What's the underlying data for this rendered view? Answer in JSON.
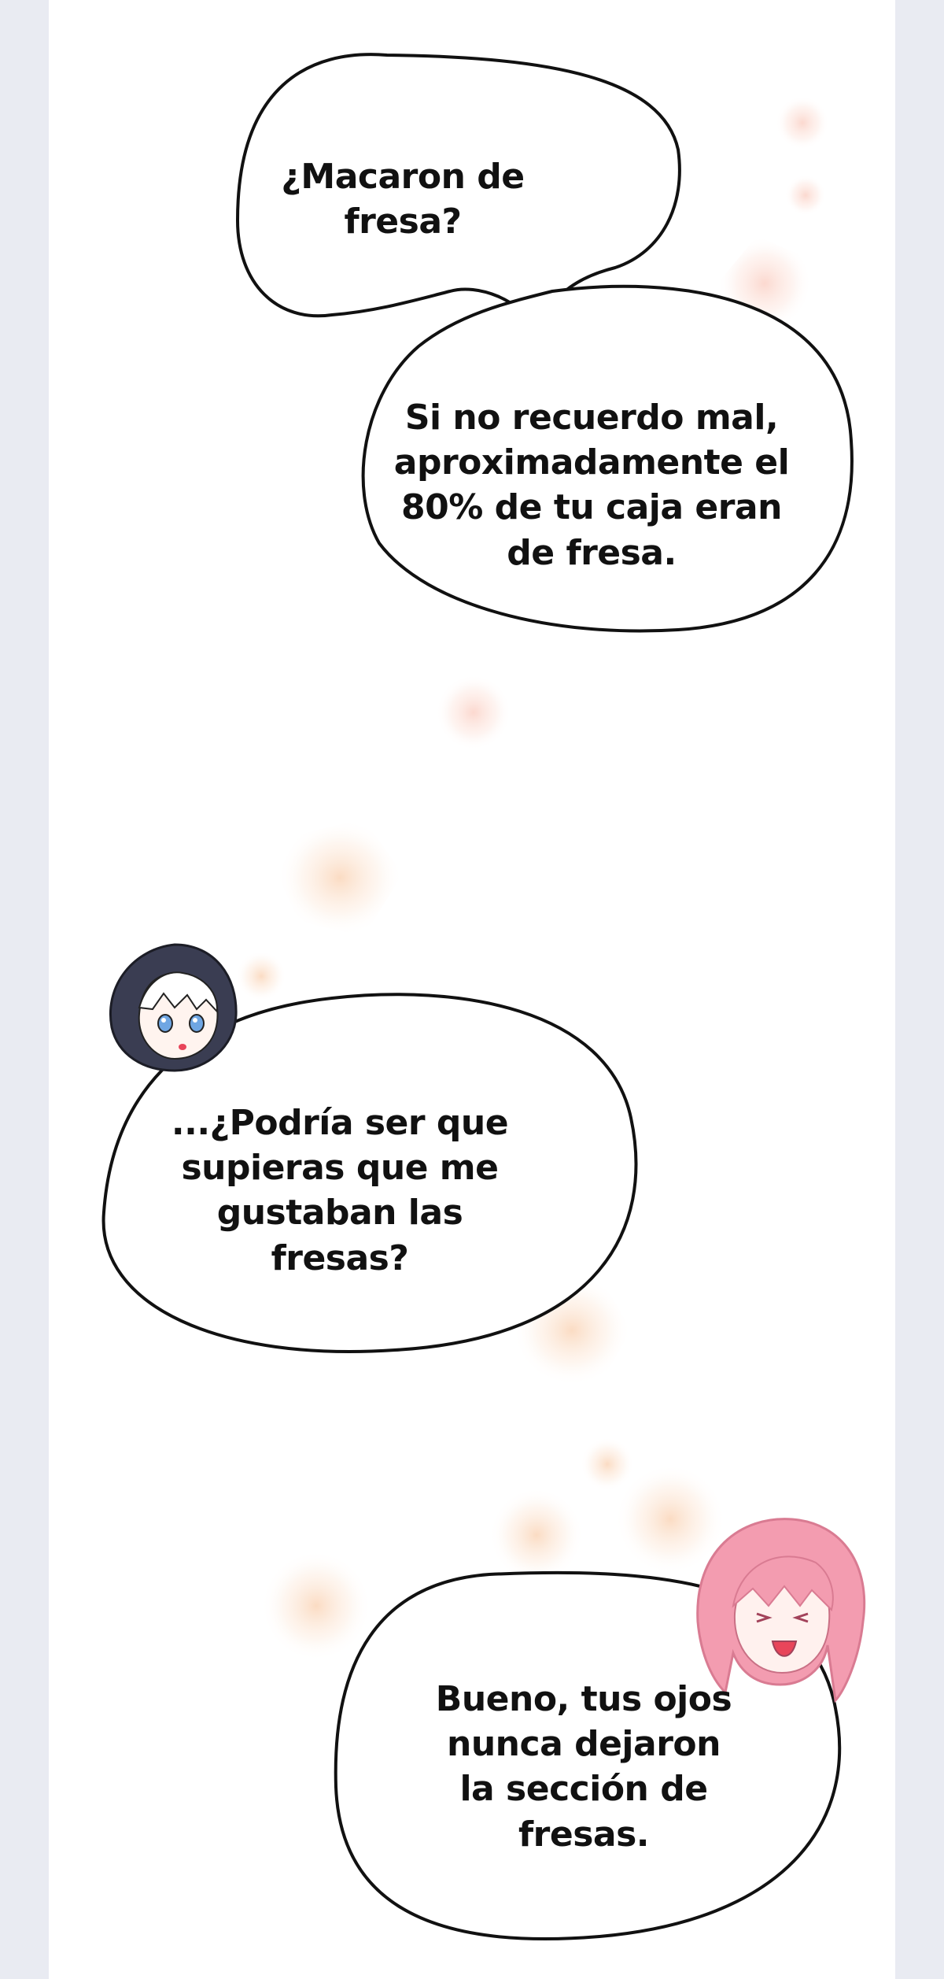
{
  "panel": {
    "bubbles": [
      {
        "text": "¿Macaron de\nfresa?"
      },
      {
        "text": "Si no recuerdo mal,\naproximadamente el\n80% de tu caja eran\nde fresa."
      },
      {
        "text": "...¿Podría ser que\nsupieras que me\ngustaban las\nfresas?"
      },
      {
        "text": "Bueno, tus ojos\nnunca dejaron\nla sección de\nfresas."
      }
    ],
    "characters": [
      {
        "icon": "hooded-boy-chibi-icon"
      },
      {
        "icon": "pink-hair-girl-chibi-icon"
      }
    ],
    "colors": {
      "viewer_background": "#e9ebf2",
      "page_background": "#ffffff",
      "bubble_outline": "#111111",
      "sparkle": "#f7c3b2"
    }
  }
}
